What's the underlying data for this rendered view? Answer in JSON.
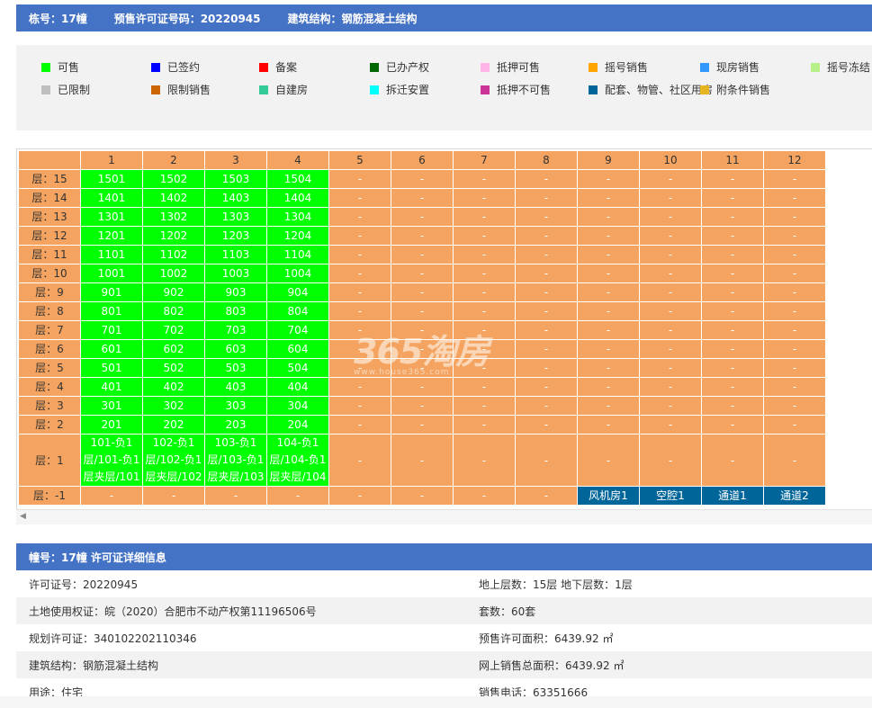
{
  "header": {
    "building": "栋号：17幢",
    "permit": "预售许可证号码：20220945",
    "structure": "建筑结构：钢筋混凝土结构"
  },
  "legend": [
    {
      "label": "可售",
      "color": "#00ff00"
    },
    {
      "label": "已签约",
      "color": "#0000ff"
    },
    {
      "label": "备案",
      "color": "#ff0000"
    },
    {
      "label": "已办产权",
      "color": "#006600"
    },
    {
      "label": "抵押可售",
      "color": "#ffb6e6"
    },
    {
      "label": "摇号销售",
      "color": "#ffa500"
    },
    {
      "label": "现房销售",
      "color": "#3399ff"
    },
    {
      "label": "摇号冻结",
      "color": "#b8f08a"
    },
    {
      "label": "已限制",
      "color": "#bfbfbf"
    },
    {
      "label": "限制销售",
      "color": "#cc6600"
    },
    {
      "label": "自建房",
      "color": "#33cc99"
    },
    {
      "label": "拆迁安置",
      "color": "#00ffff"
    },
    {
      "label": "抵押不可售",
      "color": "#cc3399"
    },
    {
      "label": "配套、物管、社区用房",
      "color": "#006699"
    },
    {
      "label": "附条件销售",
      "color": "#e6b422"
    }
  ],
  "grid": {
    "columns": [
      "1",
      "2",
      "3",
      "4",
      "5",
      "6",
      "7",
      "8",
      "9",
      "10",
      "11",
      "12"
    ],
    "rows": [
      {
        "floor": "层：15",
        "units": [
          "1501",
          "1502",
          "1503",
          "1504"
        ]
      },
      {
        "floor": "层：14",
        "units": [
          "1401",
          "1402",
          "1403",
          "1404"
        ]
      },
      {
        "floor": "层：13",
        "units": [
          "1301",
          "1302",
          "1303",
          "1304"
        ]
      },
      {
        "floor": "层：12",
        "units": [
          "1201",
          "1202",
          "1203",
          "1204"
        ]
      },
      {
        "floor": "层：11",
        "units": [
          "1101",
          "1102",
          "1103",
          "1104"
        ]
      },
      {
        "floor": "层：10",
        "units": [
          "1001",
          "1002",
          "1003",
          "1004"
        ]
      },
      {
        "floor": "层：9",
        "units": [
          "901",
          "902",
          "903",
          "904"
        ]
      },
      {
        "floor": "层：8",
        "units": [
          "801",
          "802",
          "803",
          "804"
        ]
      },
      {
        "floor": "层：7",
        "units": [
          "701",
          "702",
          "703",
          "704"
        ]
      },
      {
        "floor": "层：6",
        "units": [
          "601",
          "602",
          "603",
          "604"
        ]
      },
      {
        "floor": "层：5",
        "units": [
          "501",
          "502",
          "503",
          "504"
        ]
      },
      {
        "floor": "层：4",
        "units": [
          "401",
          "402",
          "403",
          "404"
        ]
      },
      {
        "floor": "层：3",
        "units": [
          "301",
          "302",
          "303",
          "304"
        ]
      },
      {
        "floor": "层：2",
        "units": [
          "201",
          "202",
          "203",
          "204"
        ]
      }
    ],
    "floor1": {
      "floor": "层：1",
      "units": [
        [
          "101-负1",
          "层/101-负1",
          "层夹层/101"
        ],
        [
          "102-负1",
          "层/102-负1",
          "层夹层/102"
        ],
        [
          "103-负1",
          "层/103-负1",
          "层夹层/103"
        ],
        [
          "104-负1",
          "层/104-负1",
          "层夹层/104"
        ]
      ]
    },
    "basement": {
      "floor": "层：-1",
      "units": [
        "风机房1",
        "空腔1",
        "通道1",
        "通道2"
      ]
    },
    "empty": "-"
  },
  "watermark": {
    "main": "365淘房",
    "sub": "www.house365.com"
  },
  "info": {
    "title": "幢号：17幢 许可证详细信息",
    "rows": [
      {
        "l": "许可证号：20220945",
        "r": "地上层数：15层  地下层数：1层"
      },
      {
        "l": "土地使用权证：皖（2020）合肥市不动产权第11196506号",
        "r": "套数：60套"
      },
      {
        "l": "规划许可证：340102202110346",
        "r": "预售许可面积：6439.92 ㎡"
      },
      {
        "l": "建筑结构：钢筋混凝土结构",
        "r": "网上销售总面积：6439.92 ㎡"
      },
      {
        "l": "用途：住宅",
        "r": "销售电话：63351666"
      }
    ]
  }
}
